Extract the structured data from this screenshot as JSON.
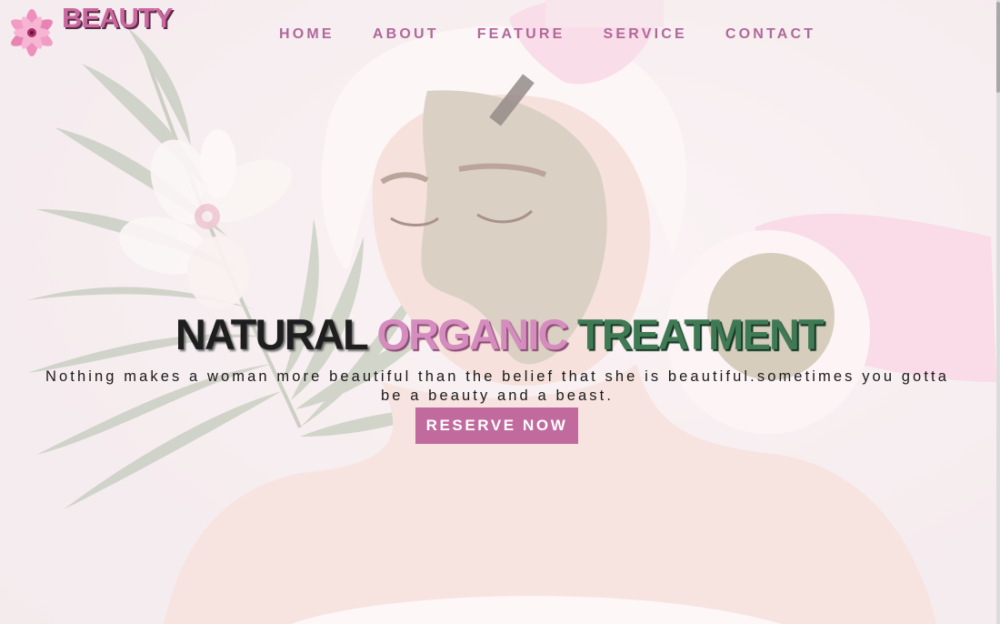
{
  "brand": {
    "name": "BEAUTY",
    "logo_icon": "pink-lily-flower-icon"
  },
  "nav": {
    "items": [
      {
        "label": "HOME"
      },
      {
        "label": "ABOUT"
      },
      {
        "label": "FEATURE"
      },
      {
        "label": "SERVICE"
      },
      {
        "label": "CONTACT"
      }
    ]
  },
  "hero": {
    "headline": {
      "word1": "NATURAL",
      "word2": "ORGANIC",
      "word3": "TREATMENT"
    },
    "tagline": "Nothing makes a woman more beautiful than the belief that she is beautiful.sometimes you gotta be a beauty and a beast.",
    "cta_label": "RESERVE NOW",
    "background_image": "woman-facial-clay-mask-spa-photo"
  },
  "colors": {
    "accent_pink": "#c06a9e",
    "nav_text": "#b0689a",
    "headline_green": "#3f7a55",
    "headline_pink": "#d58cbf",
    "headline_dark": "#1e1e1e"
  }
}
